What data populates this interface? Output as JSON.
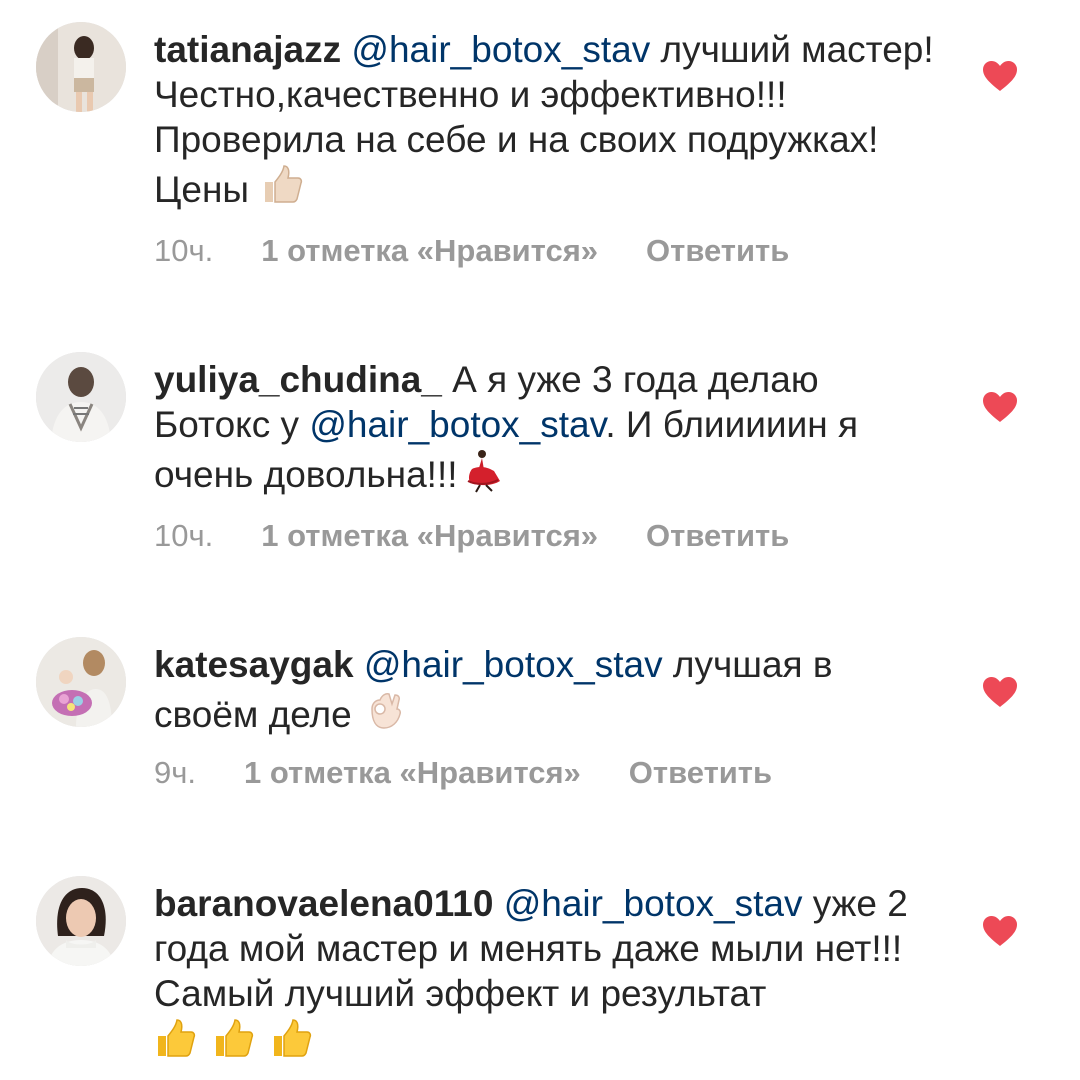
{
  "comments": [
    {
      "username": "tatianajazz",
      "mention": "@hair_botox_stav",
      "text_after": " лучший мастер! Честно,качественно и эффективно!!! Проверила на себе и на своих подружках! Цены ",
      "emoji_icon": "thumbs-up-light-icon",
      "time": "10ч.",
      "likes": "1 отметка «Нравится»",
      "reply": "Ответить"
    },
    {
      "username": "yuliya_chudina_",
      "text_before": " А я уже  3 года делаю Ботокс у ",
      "mention": "@hair_botox_stav",
      "text_after": ". И блииииин я очень довольна!!!",
      "emoji_icon": "dancer-icon",
      "time": "10ч.",
      "likes": "1 отметка «Нравится»",
      "reply": "Ответить"
    },
    {
      "username": "katesaygak",
      "mention": "@hair_botox_stav",
      "text_after": " лучшая в своём деле ",
      "emoji_icon": "ok-hand-icon",
      "time": "9ч.",
      "likes": "1 отметка «Нравится»",
      "reply": "Ответить"
    },
    {
      "username": "baranovaelena0110",
      "mention": "@hair_botox_stav",
      "text_after": " уже 2 года мой мастер и менять даже мыли нет!!! Самый лучший эффект и результат ",
      "emoji_icon": "thumbs-up-icon",
      "time": "",
      "likes": "",
      "reply": ""
    }
  ],
  "colors": {
    "text": "#262626",
    "mention": "#003569",
    "meta": "#999999",
    "heart": "#ed4956"
  }
}
